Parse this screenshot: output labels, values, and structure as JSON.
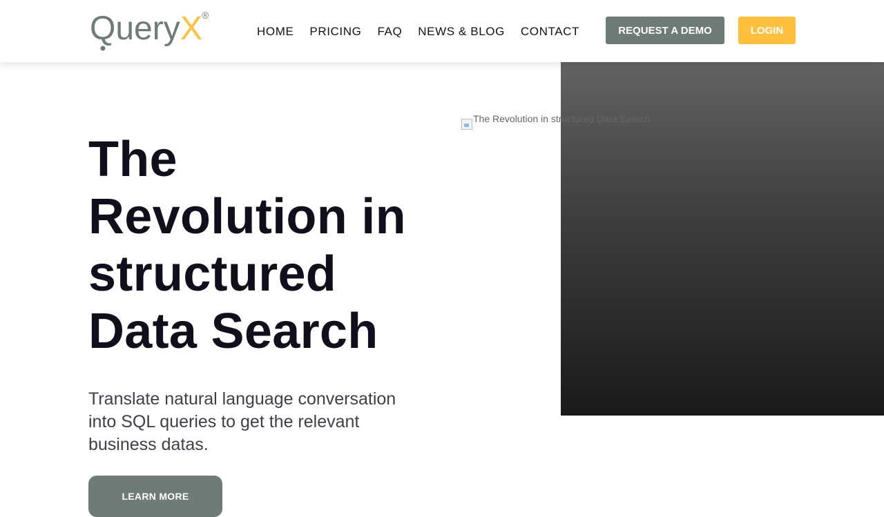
{
  "brand": {
    "logo_text_main": "Query",
    "logo_text_accent": "X",
    "logo_mark": "®",
    "colors": {
      "logo_gray": "#6e7b79",
      "accent_yellow": "#ffc03d",
      "title_dark": "#10101c"
    }
  },
  "nav": {
    "items": [
      {
        "label": "HOME"
      },
      {
        "label": "PRICING"
      },
      {
        "label": "FAQ"
      },
      {
        "label": "NEWS & BLOG"
      },
      {
        "label": "CONTACT"
      }
    ]
  },
  "header_actions": {
    "demo_label": "REQUEST A DEMO",
    "login_label": "LOGIN"
  },
  "hero": {
    "title_lines": [
      "The",
      "Revolution in",
      "structured",
      "Data Search"
    ],
    "subtitle": "Translate natural language conversation into SQL queries to get the relevant business datas.",
    "cta_label": "LEARN MORE",
    "image_alt": "The Revolution in structured Data Search"
  }
}
